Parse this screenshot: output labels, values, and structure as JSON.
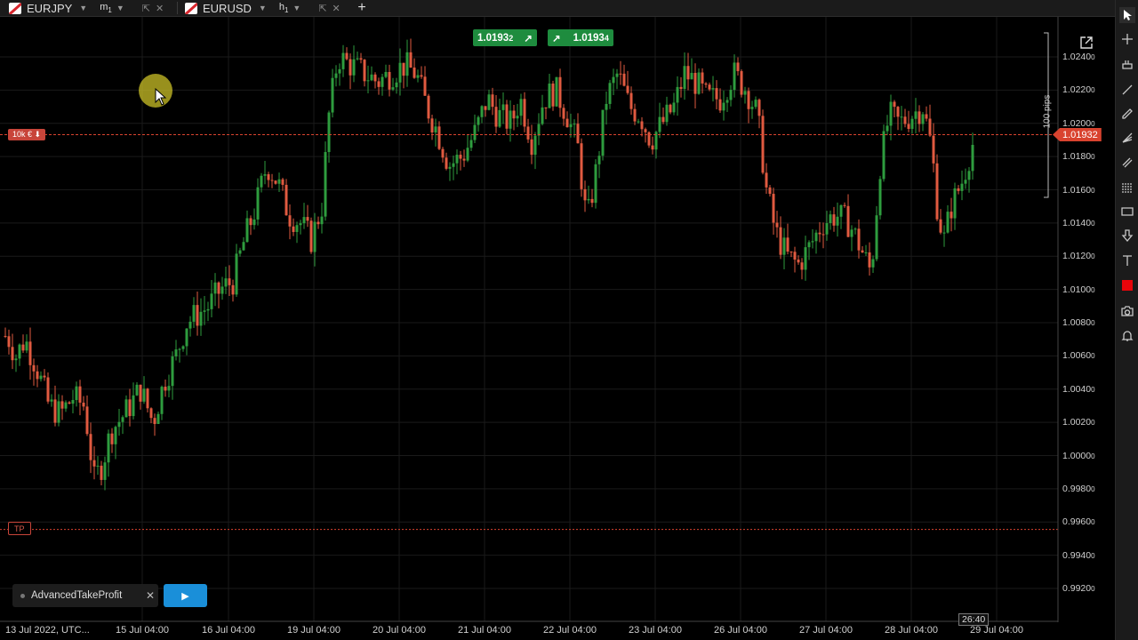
{
  "tabs": [
    {
      "symbol": "EURJPY",
      "timeframe": "m",
      "timeframe_sub": "1",
      "active": false
    },
    {
      "symbol": "EURUSD",
      "timeframe": "h",
      "timeframe_sub": "1",
      "active": true
    }
  ],
  "chart": {
    "sell_price": "1.0193",
    "sell_price_small": "2",
    "buy_price": "1.0193",
    "buy_price_small": "4",
    "position_label": "10k € ⬇",
    "tp_label": "TP",
    "current_price": "1.01932",
    "pips_label": "100 pips",
    "countdown": "26:40"
  },
  "cbot": {
    "name": "AdvancedTakeProfit",
    "close": "✕",
    "play": "▶"
  },
  "colors": {
    "bull": "#2e9c3e",
    "bear": "#e05a40",
    "price_line": "#d9432f",
    "grid": "#1a1a1a",
    "bid_bg": "#1e8c3e"
  },
  "chart_data": {
    "type": "candlestick",
    "symbol": "EURUSD",
    "timeframe": "h1",
    "y_labels": [
      {
        "text": "1.0240",
        "small": "0",
        "value": 1.024
      },
      {
        "text": "1.0220",
        "small": "0",
        "value": 1.022
      },
      {
        "text": "1.0200",
        "small": "0",
        "value": 1.02
      },
      {
        "text": "1.0180",
        "small": "0",
        "value": 1.018
      },
      {
        "text": "1.0160",
        "small": "0",
        "value": 1.016
      },
      {
        "text": "1.0140",
        "small": "0",
        "value": 1.014
      },
      {
        "text": "1.0120",
        "small": "0",
        "value": 1.012
      },
      {
        "text": "1.0100",
        "small": "0",
        "value": 1.01
      },
      {
        "text": "1.0080",
        "small": "0",
        "value": 1.008
      },
      {
        "text": "1.0060",
        "small": "0",
        "value": 1.006
      },
      {
        "text": "1.0040",
        "small": "0",
        "value": 1.004
      },
      {
        "text": "1.0020",
        "small": "0",
        "value": 1.002
      },
      {
        "text": "1.0000",
        "small": "0",
        "value": 1.0
      },
      {
        "text": "0.9980",
        "small": "0",
        "value": 0.998
      },
      {
        "text": "0.9960",
        "small": "0",
        "value": 0.996
      },
      {
        "text": "0.9940",
        "small": "0",
        "value": 0.994
      },
      {
        "text": "0.9920",
        "small": "0",
        "value": 0.992
      }
    ],
    "x_labels": [
      "13 Jul 2022, UTC...",
      "15 Jul 04:00",
      "16 Jul 04:00",
      "19 Jul 04:00",
      "20 Jul 04:00",
      "21 Jul 04:00",
      "22 Jul 04:00",
      "23 Jul 04:00",
      "26 Jul 04:00",
      "27 Jul 04:00",
      "28 Jul 04:00",
      "29 Jul 04:00"
    ],
    "current_price": 1.01932,
    "take_profit": 0.99555,
    "path": [
      [
        0,
        1.0075
      ],
      [
        10,
        1.007
      ],
      [
        18,
        1.006
      ],
      [
        28,
        1.007
      ],
      [
        40,
        1.0055
      ],
      [
        55,
        1.003
      ],
      [
        68,
        1.0025
      ],
      [
        82,
        1.0035
      ],
      [
        95,
        1.003
      ],
      [
        106,
        0.9985
      ],
      [
        115,
        0.9995
      ],
      [
        125,
        1.0015
      ],
      [
        140,
        1.0025
      ],
      [
        158,
        1.004
      ],
      [
        172,
        1.002
      ],
      [
        185,
        1.0045
      ],
      [
        198,
        1.006
      ],
      [
        210,
        1.008
      ],
      [
        222,
        1.0085
      ],
      [
        235,
        1.009
      ],
      [
        248,
        1.01
      ],
      [
        262,
        1.0105
      ],
      [
        275,
        1.013
      ],
      [
        288,
        1.015
      ],
      [
        300,
        1.0175
      ],
      [
        312,
        1.0165
      ],
      [
        325,
        1.0145
      ],
      [
        338,
        1.014
      ],
      [
        350,
        1.013
      ],
      [
        362,
        1.015
      ],
      [
        370,
        1.0205
      ],
      [
        380,
        1.024
      ],
      [
        395,
        1.0235
      ],
      [
        410,
        1.023
      ],
      [
        425,
        1.0225
      ],
      [
        440,
        1.023
      ],
      [
        455,
        1.0235
      ],
      [
        468,
        1.023
      ],
      [
        480,
        1.021
      ],
      [
        492,
        1.0195
      ],
      [
        505,
        1.0175
      ],
      [
        520,
        1.018
      ],
      [
        535,
        1.0195
      ],
      [
        548,
        1.0215
      ],
      [
        560,
        1.0205
      ],
      [
        575,
        1.02
      ],
      [
        585,
        1.0215
      ],
      [
        598,
        1.019
      ],
      [
        612,
        1.0215
      ],
      [
        625,
        1.022
      ],
      [
        638,
        1.0205
      ],
      [
        650,
        1.0185
      ],
      [
        660,
        1.014
      ],
      [
        670,
        1.017
      ],
      [
        682,
        1.0215
      ],
      [
        695,
        1.023
      ],
      [
        708,
        1.021
      ],
      [
        720,
        1.0205
      ],
      [
        732,
        1.019
      ],
      [
        745,
        1.02
      ],
      [
        758,
        1.021
      ],
      [
        770,
        1.023
      ],
      [
        782,
        1.0225
      ],
      [
        795,
        1.0215
      ],
      [
        810,
        1.0215
      ],
      [
        825,
        1.023
      ],
      [
        840,
        1.022
      ],
      [
        852,
        1.0205
      ],
      [
        862,
        1.016
      ],
      [
        872,
        1.0135
      ],
      [
        885,
        1.012
      ],
      [
        898,
        1.0115
      ],
      [
        910,
        1.0125
      ],
      [
        925,
        1.014
      ],
      [
        940,
        1.0145
      ],
      [
        955,
        1.014
      ],
      [
        968,
        1.0125
      ],
      [
        980,
        1.011
      ],
      [
        990,
        1.0175
      ],
      [
        1000,
        1.0205
      ],
      [
        1012,
        1.02
      ],
      [
        1025,
        1.0205
      ],
      [
        1038,
        1.021
      ],
      [
        1048,
        1.0185
      ],
      [
        1055,
        1.0145
      ],
      [
        1062,
        1.013
      ],
      [
        1070,
        1.015
      ],
      [
        1082,
        1.0165
      ],
      [
        1090,
        1.018
      ],
      [
        1097,
        1.0193
      ]
    ]
  }
}
